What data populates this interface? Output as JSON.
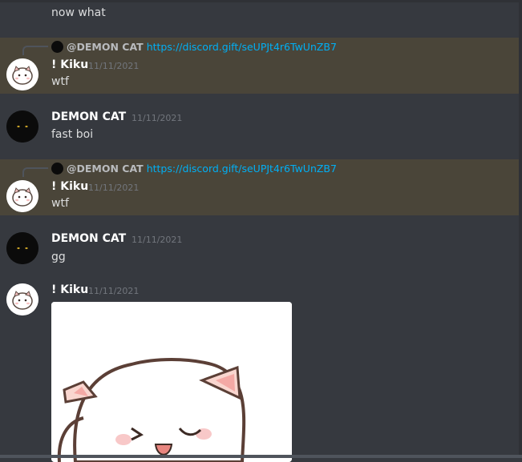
{
  "messages": [
    {
      "text": "now what"
    },
    {
      "reply": {
        "mention": "@DEMON CAT",
        "link": "https://discord.gift/seUPJt4r6TwUnZB7"
      },
      "author": "! Kiku",
      "timestamp": "11/11/2021",
      "text": "wtf"
    },
    {
      "author": "DEMON CAT",
      "timestamp": "11/11/2021",
      "text": "fast boi"
    },
    {
      "reply": {
        "mention": "@DEMON CAT",
        "link": "https://discord.gift/seUPJt4r6TwUnZB7"
      },
      "author": "! Kiku",
      "timestamp": "11/11/2021",
      "text": "wtf"
    },
    {
      "author": "DEMON CAT",
      "timestamp": "11/11/2021",
      "text": "gg"
    },
    {
      "author": "! Kiku",
      "timestamp": "11/11/2021"
    }
  ],
  "colors": {
    "background": "#36393f",
    "highlight": "#4a4539",
    "link": "#00aff4",
    "timestamp": "#72767d"
  },
  "icons": {
    "kiku_avatar": "white-cat-avatar",
    "demon_avatar": "black-cat-avatar"
  }
}
